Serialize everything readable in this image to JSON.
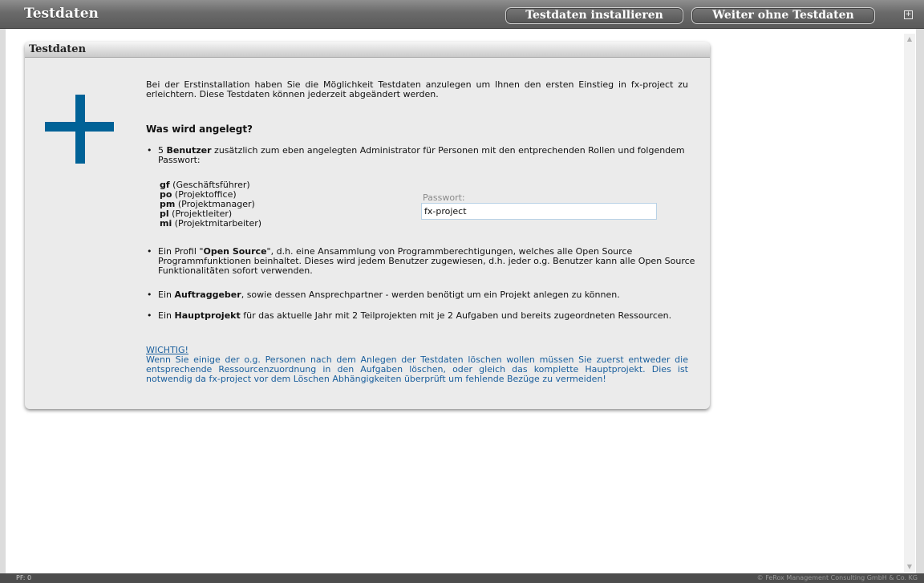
{
  "header": {
    "title": "Testdaten",
    "install_label": "Testdaten installieren",
    "skip_label": "Weiter ohne Testdaten",
    "corner_icon": "expand-icon"
  },
  "panel": {
    "title": "Testdaten",
    "icon": "plus-icon",
    "icon_color": "#006297",
    "intro": "Bei der Erstinstallation haben Sie die Möglichkeit Testdaten anzulegen um Ihnen den ersten Einstieg in fx-project zu erleichtern. Diese Testdaten können jederzeit abgeändert werden.",
    "heading": "Was wird angelegt?",
    "users": {
      "count": "5",
      "label": "Benutzer",
      "text": " zusätzlich zum eben angelegten Administrator für Personen mit den entprechenden Rollen und folgendem Passwort:"
    },
    "roles": [
      {
        "code": "gf",
        "name": " (Geschäftsführer)"
      },
      {
        "code": "po",
        "name": " (Projektoffice)"
      },
      {
        "code": "pm",
        "name": " (Projektmanager)"
      },
      {
        "code": "pl",
        "name": " (Projektleiter)"
      },
      {
        "code": "mi",
        "name": " (Projektmitarbeiter)"
      }
    ],
    "password": {
      "label": "Passwort:",
      "value": "fx-project"
    },
    "open_source": {
      "pre": "Ein Profil \"",
      "bold": "Open Source",
      "post": "\", d.h. eine Ansammlung von Programmberechtigungen, welches alle Open Source Programmfunktionen beinhaltet. Dieses wird jedem Benutzer zugewiesen, d.h. jeder o.g. Benutzer kann alle Open Source Funktionalitäten sofort verwenden."
    },
    "client": {
      "pre": "Ein ",
      "bold": "Auftraggeber",
      "post": ", sowie dessen Ansprechpartner - werden benötigt um ein Projekt anlegen zu können."
    },
    "project": {
      "pre": "Ein ",
      "bold": "Hauptprojekt",
      "post": " für das aktuelle Jahr mit 2 Teilprojekten mit je 2 Aufgaben und bereits zugeordneten Ressourcen."
    },
    "warning": {
      "title": "WICHTIG!",
      "text": "Wenn Sie einige der o.g. Personen nach dem Anlegen der Testdaten löschen wollen müssen Sie zuerst entweder die entsprechende Ressourcenzuordnung in den Aufgaben löschen, oder gleich das komplette Hauptprojekt. Dies ist notwendig da fx-project vor dem Löschen Abhängigkeiten überprüft um fehlende Bezüge zu vermeiden!",
      "color": "#1a5f9d"
    }
  },
  "statusbar": {
    "left": "PF: 0",
    "right": "© FeRox Management Consulting GmbH & Co. KG"
  }
}
